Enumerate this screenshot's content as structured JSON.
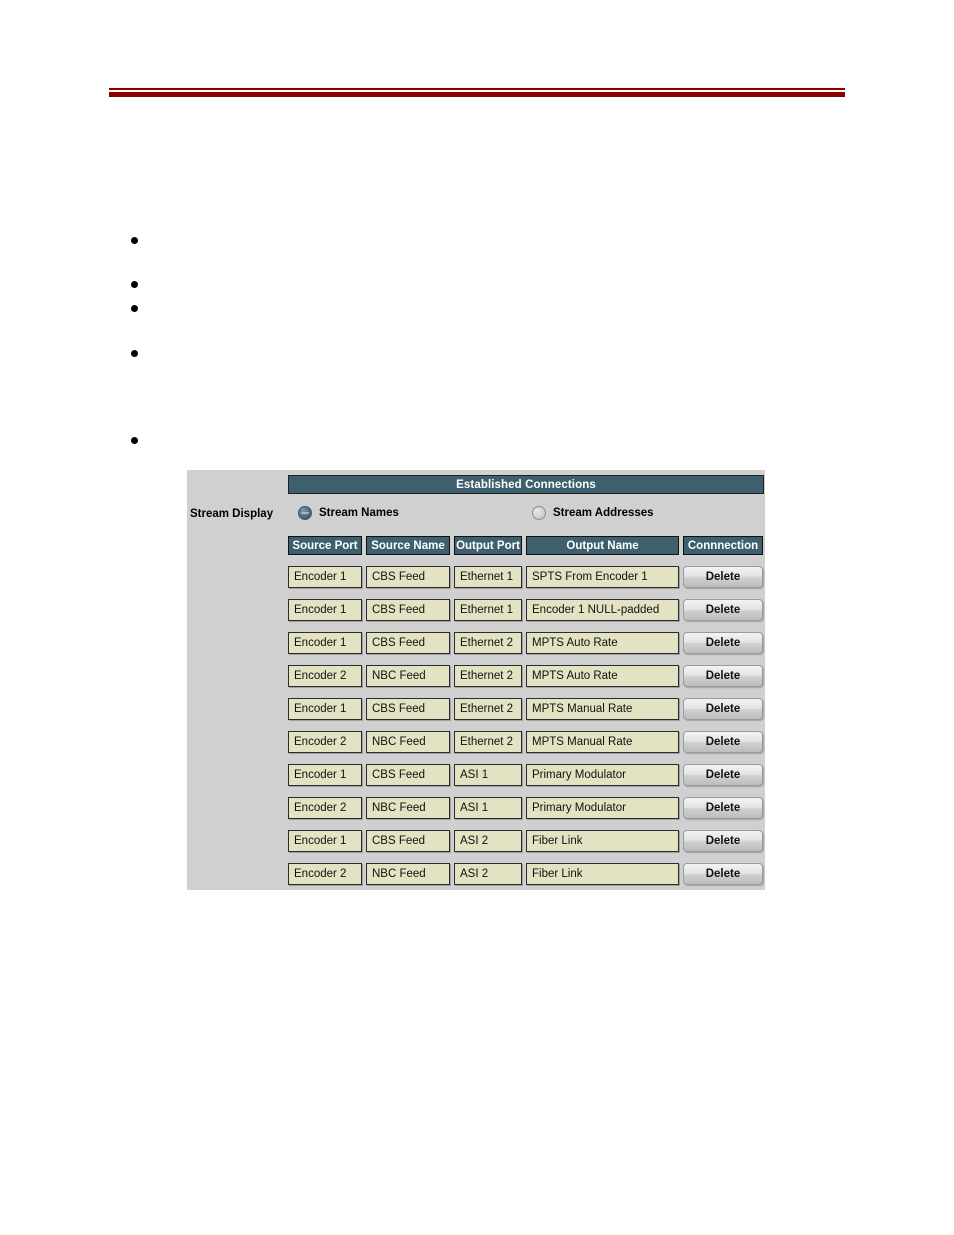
{
  "page": {
    "header_rule_color": "#8b0000",
    "bullets": [
      {
        "text": ""
      },
      {
        "text": ""
      },
      {
        "text": ""
      },
      {
        "text": ""
      },
      {
        "text": ""
      }
    ]
  },
  "panel": {
    "title": "Established Connections",
    "background": "#d0d0d0",
    "header_color": "#3d5f6e",
    "cell_color": "#e3e3c3",
    "stream_display": {
      "label": "Stream Display",
      "options": [
        {
          "label": "Stream Names",
          "selected": true,
          "icon": "radio-selected-icon"
        },
        {
          "label": "Stream Addresses",
          "selected": false,
          "icon": "radio-unselected-icon"
        }
      ]
    },
    "table": {
      "columns": [
        "Source Port",
        "Source Name",
        "Output Port",
        "Output Name",
        "Connnection"
      ],
      "rows": [
        {
          "source_port": "Encoder 1",
          "source_name": "CBS Feed",
          "output_port": "Ethernet 1",
          "output_name": "SPTS From Encoder 1",
          "action": "Delete"
        },
        {
          "source_port": "Encoder 1",
          "source_name": "CBS Feed",
          "output_port": "Ethernet 1",
          "output_name": "Encoder 1 NULL-padded",
          "action": "Delete"
        },
        {
          "source_port": "Encoder 1",
          "source_name": "CBS Feed",
          "output_port": "Ethernet 2",
          "output_name": "MPTS Auto Rate",
          "action": "Delete"
        },
        {
          "source_port": "Encoder 2",
          "source_name": "NBC Feed",
          "output_port": "Ethernet 2",
          "output_name": "MPTS Auto Rate",
          "action": "Delete"
        },
        {
          "source_port": "Encoder 1",
          "source_name": "CBS Feed",
          "output_port": "Ethernet 2",
          "output_name": "MPTS Manual Rate",
          "action": "Delete"
        },
        {
          "source_port": "Encoder 2",
          "source_name": "NBC Feed",
          "output_port": "Ethernet 2",
          "output_name": "MPTS Manual Rate",
          "action": "Delete"
        },
        {
          "source_port": "Encoder 1",
          "source_name": "CBS Feed",
          "output_port": "ASI 1",
          "output_name": "Primary Modulator",
          "action": "Delete"
        },
        {
          "source_port": "Encoder 2",
          "source_name": "NBC Feed",
          "output_port": "ASI 1",
          "output_name": "Primary Modulator",
          "action": "Delete"
        },
        {
          "source_port": "Encoder 1",
          "source_name": "CBS Feed",
          "output_port": "ASI 2",
          "output_name": "Fiber Link",
          "action": "Delete"
        },
        {
          "source_port": "Encoder 2",
          "source_name": "NBC Feed",
          "output_port": "ASI 2",
          "output_name": "Fiber Link",
          "action": "Delete"
        }
      ]
    }
  }
}
